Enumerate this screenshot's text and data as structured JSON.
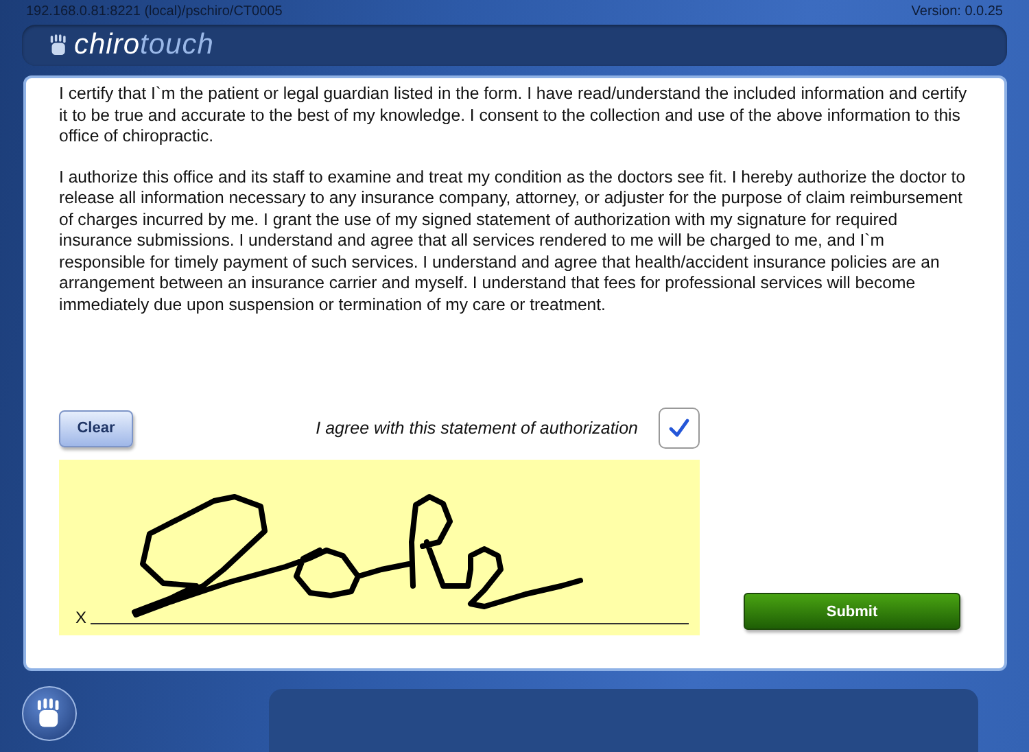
{
  "status_bar": {
    "address": "192.168.0.81:8221 (local)/pschiro/CT0005",
    "version": "Version: 0.0.25"
  },
  "header": {
    "logo_first": "chiro",
    "logo_second": "touch"
  },
  "paragraphs": [
    "I certify that I`m the patient or legal guardian listed in the form. I have read/understand the included information and certify it to be true and accurate to the best of my knowledge. I consent to the collection and use of the above information to this office of chiropractic.",
    "I authorize this office and its staff to examine and treat my condition as the doctors see fit. I hereby authorize the doctor to release all information necessary to any insurance company, attorney, or adjuster for the purpose of claim reimbursement of charges incurred by me. I grant the use of my signed statement of authorization with my signature for required insurance submissions. I understand and agree that all services rendered to me will be charged to me, and I`m responsible for timely payment of such services. I understand and agree that health/accident insurance policies are an arrangement between an insurance carrier and myself. I understand that fees for professional services will become immediately due upon suspension or termination of my care or treatment."
  ],
  "clear_button": "Clear",
  "agreement": {
    "label": "I agree with this statement of authorization",
    "checked": true
  },
  "signature": {
    "mark": "X"
  },
  "submit_button": "Submit"
}
